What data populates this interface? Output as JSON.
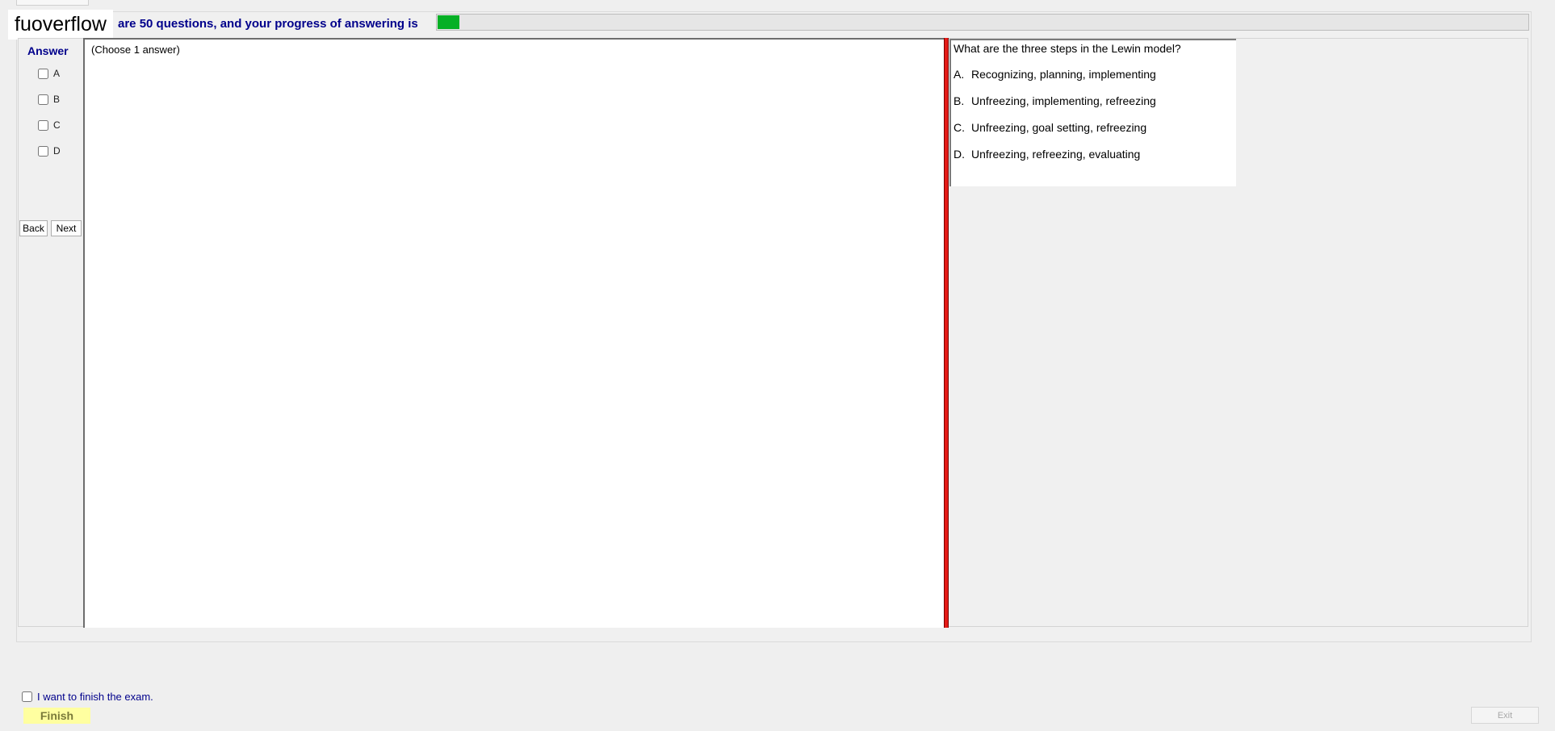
{
  "watermark": "fuoverflow",
  "header": {
    "info_text": "are 50 questions, and your progress of answering is",
    "progress_fraction": 0.02,
    "progress_color": "#06b025"
  },
  "answer_panel": {
    "label": "Answer",
    "options": [
      "A",
      "B",
      "C",
      "D"
    ],
    "back_label": "Back",
    "next_label": "Next"
  },
  "answer_area": {
    "instruction": "(Choose 1 answer)"
  },
  "question": {
    "text": "What are the three steps in the Lewin model?",
    "options": [
      {
        "letter": "A.",
        "text": "Recognizing, planning, implementing"
      },
      {
        "letter": "B.",
        "text": "Unfreezing, implementing, refreezing"
      },
      {
        "letter": "C.",
        "text": "Unfreezing, goal setting, refreezing"
      },
      {
        "letter": "D.",
        "text": "Unfreezing, refreezing, evaluating"
      }
    ]
  },
  "footer": {
    "finish_check_label": "I want to finish the exam.",
    "finish_label": "Finish",
    "exit_label": "Exit"
  },
  "colors": {
    "accent_text": "#00008b",
    "splitter": "#e41b17",
    "finish_bg": "#ffffa0"
  }
}
